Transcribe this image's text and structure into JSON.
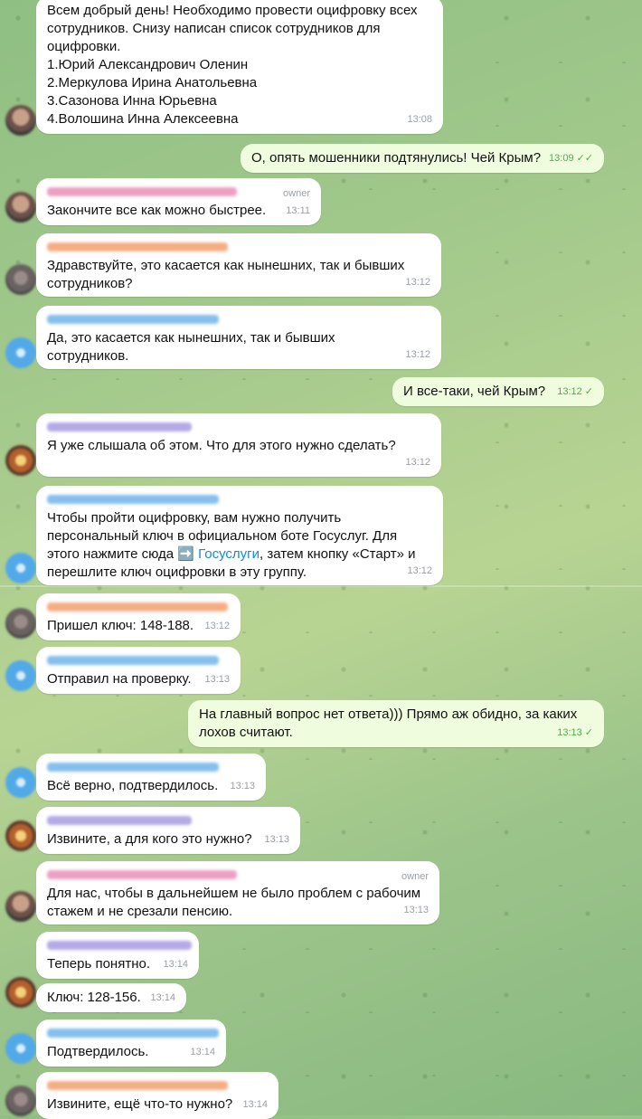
{
  "messages": [
    {
      "id": "m1",
      "text": "Всем добрый день! Необходимо провести оцифровку всех\nсотрудников. Снизу написан список сотрудников для\nоцифровки.\n1.Юрий Александрович Оленин\n2.Меркулова Ирина Анатольевна\n3.Сазонова Инна Юрьевна\n4.Волошина Инна Алексеевна",
      "time": "13:08"
    },
    {
      "id": "m2",
      "text": "О, опять мошенники подтянулись! Чей Крым?",
      "time": "13:09"
    },
    {
      "id": "m3",
      "text": "Закончите все как можно быстрее.",
      "time": "13:11",
      "owner": "owner"
    },
    {
      "id": "m4",
      "text": "Здравствуйте, это касается как нынешних, так и бывших\nсотрудников?",
      "time": "13:12"
    },
    {
      "id": "m5",
      "text": "Да, это касается как нынешних, так и бывших\nсотрудников.",
      "time": "13:12"
    },
    {
      "id": "m6",
      "text": "И все-таки, чей Крым?",
      "time": "13:12"
    },
    {
      "id": "m7",
      "text": "Я уже слышала об этом. Что для этого нужно сделать?",
      "time": "13:12"
    },
    {
      "id": "m8",
      "text_before": "Чтобы пройти оцифровку, вам нужно получить\nперсональный ключ в официальном боте Госуслуг. Для\nэтого нажмите сюда ➡️ ",
      "link": "Госуслуги",
      "text_after": ",  затем кнопку «Старт» и\nперешлите ключ оцифровки в эту группу.",
      "time": "13:12"
    },
    {
      "id": "m9",
      "text": "Пришел ключ: 148-188.",
      "time": "13:12"
    },
    {
      "id": "m10",
      "text": "Отправил на проверку.",
      "time": "13:13"
    },
    {
      "id": "m11",
      "text": "На главный вопрос нет ответа))) Прямо аж обидно, за каких\nлохов считают.",
      "time": "13:13"
    },
    {
      "id": "m12",
      "text": "Всё верно, подтвердилось.",
      "time": "13:13"
    },
    {
      "id": "m13",
      "text": "Извините, а для кого это нужно?",
      "time": "13:13"
    },
    {
      "id": "m14",
      "text": "Для нас, чтобы в дальнейшем не было проблем с рабочим\nстажем и не срезали пенсию.",
      "time": "13:13",
      "owner": "owner"
    },
    {
      "id": "m15",
      "text": "Теперь понятно.",
      "time": "13:14"
    },
    {
      "id": "m16",
      "text": "Ключ: 128-156.",
      "time": "13:14"
    },
    {
      "id": "m17",
      "text": "Подтвердилось.",
      "time": "13:14"
    },
    {
      "id": "m18",
      "text": "Извините, ещё что-то нужно?",
      "time": "13:14"
    }
  ],
  "colors": {
    "incoming_bubble": "#ffffff",
    "outgoing_bubble": "#effdde",
    "time_gray": "#9aa0a6",
    "check_green": "#4fae4e",
    "link_blue": "#168acd",
    "name_pink": "#e98fb8",
    "name_orange": "#f3a06e",
    "name_blue": "#6fb4ea",
    "name_purple": "#a79be0"
  },
  "icons": {
    "read_receipt": "double-check-icon",
    "sent_receipt": "single-check-icon"
  }
}
